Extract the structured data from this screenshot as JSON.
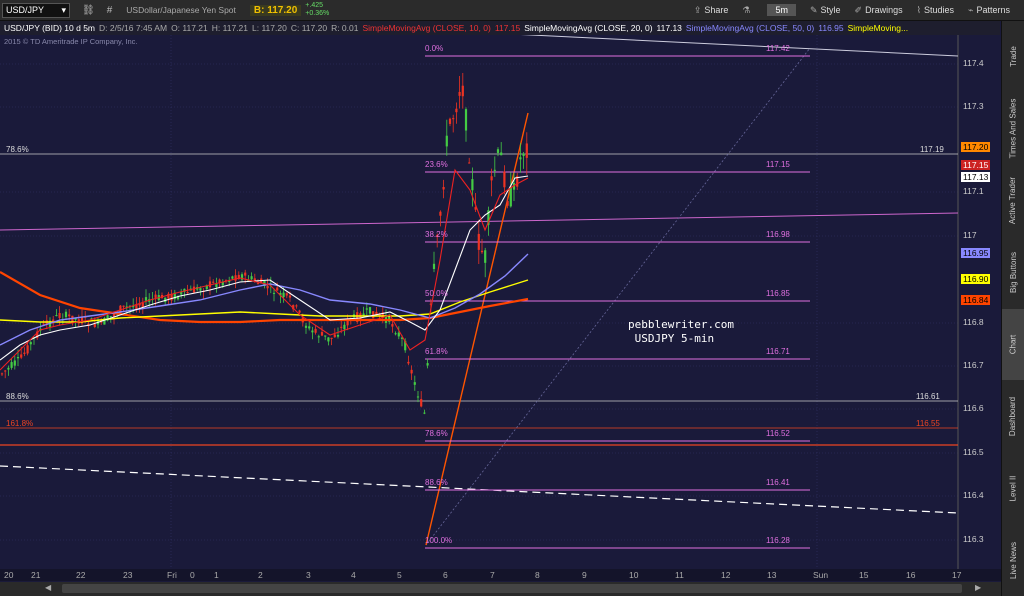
{
  "toolbar": {
    "symbol": "USD/JPY",
    "instrument_name": "USDollar/Japanese Yen Spot",
    "bid_label": "B: 117.20",
    "change_abs": "+.425",
    "change_pct": "+0.36%",
    "share": "Share",
    "timeframe": "5m",
    "style": "Style",
    "drawings": "Drawings",
    "studies": "Studies",
    "patterns": "Patterns"
  },
  "studybar": {
    "description": "USD/JPY (BID) 10 d 5m",
    "date": "D: 2/5/16 7:45 AM",
    "open": "O: 117.21",
    "high": "H: 117.21",
    "low": "L: 117.20",
    "close": "C: 117.20",
    "range": "R: 0.01",
    "sma20_label": "SimpleMovingAvg (CLOSE, 10, 0)",
    "sma20_value": "117.15",
    "sma_close20_label": "SimpleMovingAvg (CLOSE, 20, 0)",
    "sma_close20_value": "117.13",
    "sma50_label": "SimpleMovingAvg (CLOSE, 50, 0)",
    "sma50_value": "116.95",
    "sma_more_label": "SimpleMoving..."
  },
  "copyright": "2015 © TD Ameritrade IP Company, Inc.",
  "watermark": "pebblewriter.com\n USDJPY 5-min",
  "side_tabs": [
    "Trade",
    "Times And Sales",
    "Active Trader",
    "Big Buttons",
    "Chart",
    "Dashboard",
    "Level II",
    "Live News"
  ],
  "y_axis": [
    "117.4",
    "117.3",
    "117.1",
    "117",
    "116.8",
    "116.7",
    "116.6",
    "116.5",
    "116.4",
    "116.3"
  ],
  "y_badges": [
    {
      "text": "117.20",
      "bg": "#ff8800",
      "fg": "#000000"
    },
    {
      "text": "117.15",
      "bg": "#cc2222",
      "fg": "#ffffff"
    },
    {
      "text": "117.13",
      "bg": "#ffffff",
      "fg": "#000000"
    },
    {
      "text": "116.95",
      "bg": "#8888ff",
      "fg": "#000000"
    },
    {
      "text": "116.90",
      "bg": "#ffff00",
      "fg": "#000000"
    },
    {
      "text": "116.84",
      "bg": "#ff4400",
      "fg": "#000000"
    }
  ],
  "fib_levels": [
    {
      "pct": "0.0%",
      "price": "117.42"
    },
    {
      "pct": "23.6%",
      "price": "117.15"
    },
    {
      "pct": "38.2%",
      "price": "116.98"
    },
    {
      "pct": "50.0%",
      "price": "116.85"
    },
    {
      "pct": "61.8%",
      "price": "116.71"
    },
    {
      "pct": "78.6%",
      "price": "116.52"
    },
    {
      "pct": "88.6%",
      "price": "116.41"
    },
    {
      "pct": "100.0%",
      "price": "116.28"
    }
  ],
  "ext_lines": [
    {
      "label": "78.6%",
      "price": "117.19"
    },
    {
      "label": "88.6%",
      "price": "116.61"
    },
    {
      "label": "161.8%",
      "price": "116.55"
    }
  ],
  "x_axis": [
    "20",
    "21",
    "22",
    "23",
    "Fri",
    "0",
    "1",
    "2",
    "3",
    "4",
    "5",
    "6",
    "7",
    "8",
    "9",
    "10",
    "11",
    "12",
    "13",
    "Sun",
    "15",
    "16",
    "17"
  ],
  "colors": {
    "background": "#1a1a3a",
    "fib": "#e070e0",
    "up_candle": "#44cc44",
    "down_candle": "#ee3322",
    "sma10": "#ee2222",
    "sma20": "#ffffff",
    "sma50": "#8888ff",
    "sma100": "#ffff00",
    "sma200": "#ff4400"
  }
}
